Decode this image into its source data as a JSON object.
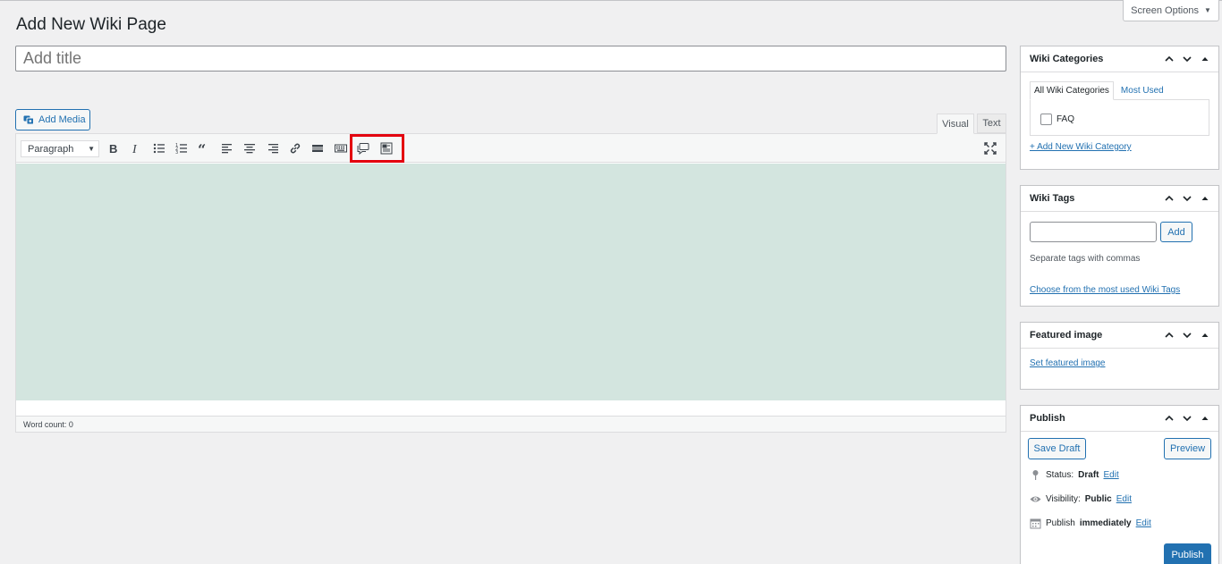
{
  "header": {
    "page_title": "Add New Wiki Page",
    "screen_options": "Screen Options"
  },
  "editor": {
    "title_placeholder": "Add title",
    "add_media": "Add Media",
    "tabs": {
      "visual": "Visual",
      "text": "Text"
    },
    "format_select": "Paragraph",
    "toolbar_icons": [
      "bold-icon",
      "italic-icon",
      "bullet-list-icon",
      "numbered-list-icon",
      "blockquote-icon",
      "align-left-icon",
      "align-center-icon",
      "align-right-icon",
      "link-icon",
      "read-more-icon",
      "toolbar-toggle-icon",
      "speech-bubble-icon",
      "template-icon",
      "fullscreen-icon"
    ],
    "word_count": "Word count: 0",
    "highlight_color": "#e3000f",
    "content_bg": "#d3e5df"
  },
  "sidebar": {
    "categories": {
      "title": "Wiki Categories",
      "tab_all": "All Wiki Categories",
      "tab_most_used": "Most Used",
      "items": [
        "FAQ"
      ],
      "add_link": "+ Add New Wiki Category"
    },
    "tags": {
      "title": "Wiki Tags",
      "add_button": "Add",
      "hint": "Separate tags with commas",
      "choose_link": "Choose from the most used Wiki Tags"
    },
    "featured_image": {
      "title": "Featured image",
      "set_link": "Set featured image"
    },
    "publish": {
      "title": "Publish",
      "save_draft": "Save Draft",
      "preview": "Preview",
      "status_label": "Status:",
      "status_value": "Draft",
      "visibility_label": "Visibility:",
      "visibility_value": "Public",
      "publish_label": "Publish",
      "publish_value": "immediately",
      "edit": "Edit",
      "publish_button": "Publish",
      "accent_color": "#2271b1"
    }
  }
}
